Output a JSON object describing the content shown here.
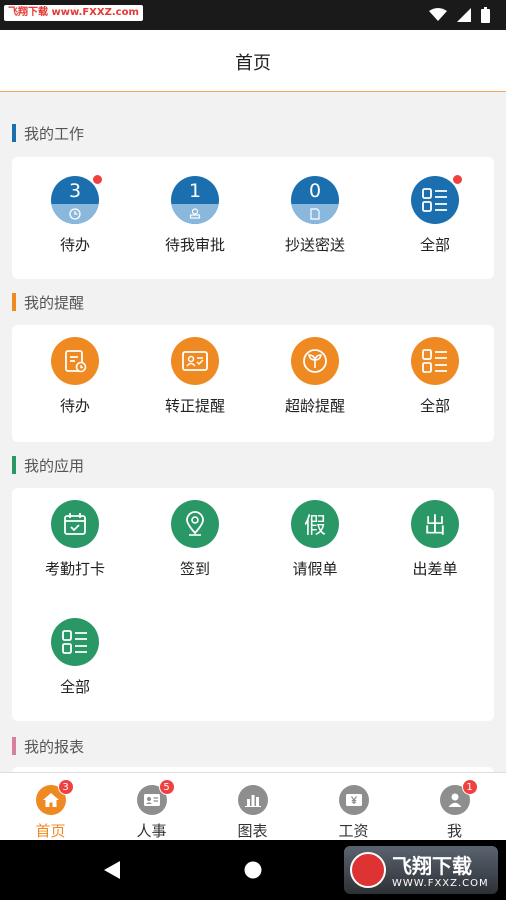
{
  "statusbar": {
    "watermark": "飞翔下载 www.FXXZ.com"
  },
  "header": {
    "title": "首页"
  },
  "sections": {
    "work": {
      "title": "我的工作",
      "color": "#1b6fae",
      "items": [
        {
          "label": "待办",
          "count": "3",
          "dot": true
        },
        {
          "label": "待我审批",
          "count": "1",
          "dot": false
        },
        {
          "label": "抄送密送",
          "count": "0",
          "dot": false
        },
        {
          "label": "全部",
          "dot": true
        }
      ]
    },
    "remind": {
      "title": "我的提醒",
      "color": "#ef8a22",
      "items": [
        {
          "label": "待办"
        },
        {
          "label": "转正提醒"
        },
        {
          "label": "超龄提醒"
        },
        {
          "label": "全部"
        }
      ]
    },
    "apps": {
      "title": "我的应用",
      "color": "#2a9866",
      "items": [
        {
          "label": "考勤打卡"
        },
        {
          "label": "签到"
        },
        {
          "label": "请假单",
          "glyph": "假"
        },
        {
          "label": "出差单",
          "glyph": "出"
        },
        {
          "label": "全部"
        }
      ]
    },
    "reports": {
      "title": "我的报表",
      "color": "#d6809e"
    }
  },
  "bottom_nav": [
    {
      "label": "首页",
      "badge": "3",
      "active": true
    },
    {
      "label": "人事",
      "badge": "5"
    },
    {
      "label": "图表"
    },
    {
      "label": "工资"
    },
    {
      "label": "我",
      "badge": "1"
    }
  ],
  "watermark_br": {
    "logo_text": "飞翔下载",
    "url": "WWW.FXXZ.COM"
  }
}
